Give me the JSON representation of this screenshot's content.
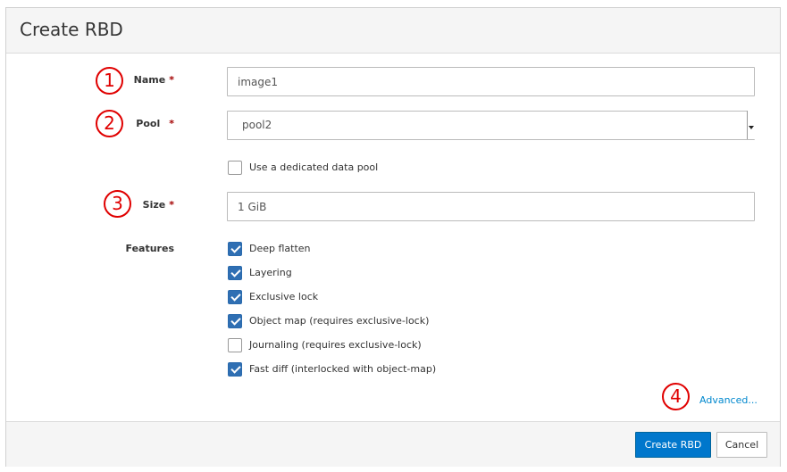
{
  "dialog": {
    "title": "Create RBD"
  },
  "form": {
    "name": {
      "label": "Name",
      "required_mark": "*",
      "value": "image1"
    },
    "pool": {
      "label": "Pool",
      "required_mark": "*",
      "selected": "pool2"
    },
    "dedicated_pool": {
      "label": "Use a dedicated data pool",
      "checked": false
    },
    "size": {
      "label": "Size",
      "required_mark": "*",
      "value": "1 GiB"
    },
    "features": {
      "label": "Features",
      "items": [
        {
          "label": "Deep flatten",
          "checked": true
        },
        {
          "label": "Layering",
          "checked": true
        },
        {
          "label": "Exclusive lock",
          "checked": true
        },
        {
          "label": "Object map (requires exclusive-lock)",
          "checked": true
        },
        {
          "label": "Journaling (requires exclusive-lock)",
          "checked": false
        },
        {
          "label": "Fast diff (interlocked with object-map)",
          "checked": true
        }
      ]
    },
    "advanced_link": "Advanced..."
  },
  "callouts": [
    "1",
    "2",
    "3",
    "4"
  ],
  "footer": {
    "submit_label": "Create RBD",
    "cancel_label": "Cancel"
  },
  "colors": {
    "primary": "#0077cc",
    "checkbox": "#2f6fb3",
    "callout": "#e00000",
    "link": "#0088ce"
  }
}
